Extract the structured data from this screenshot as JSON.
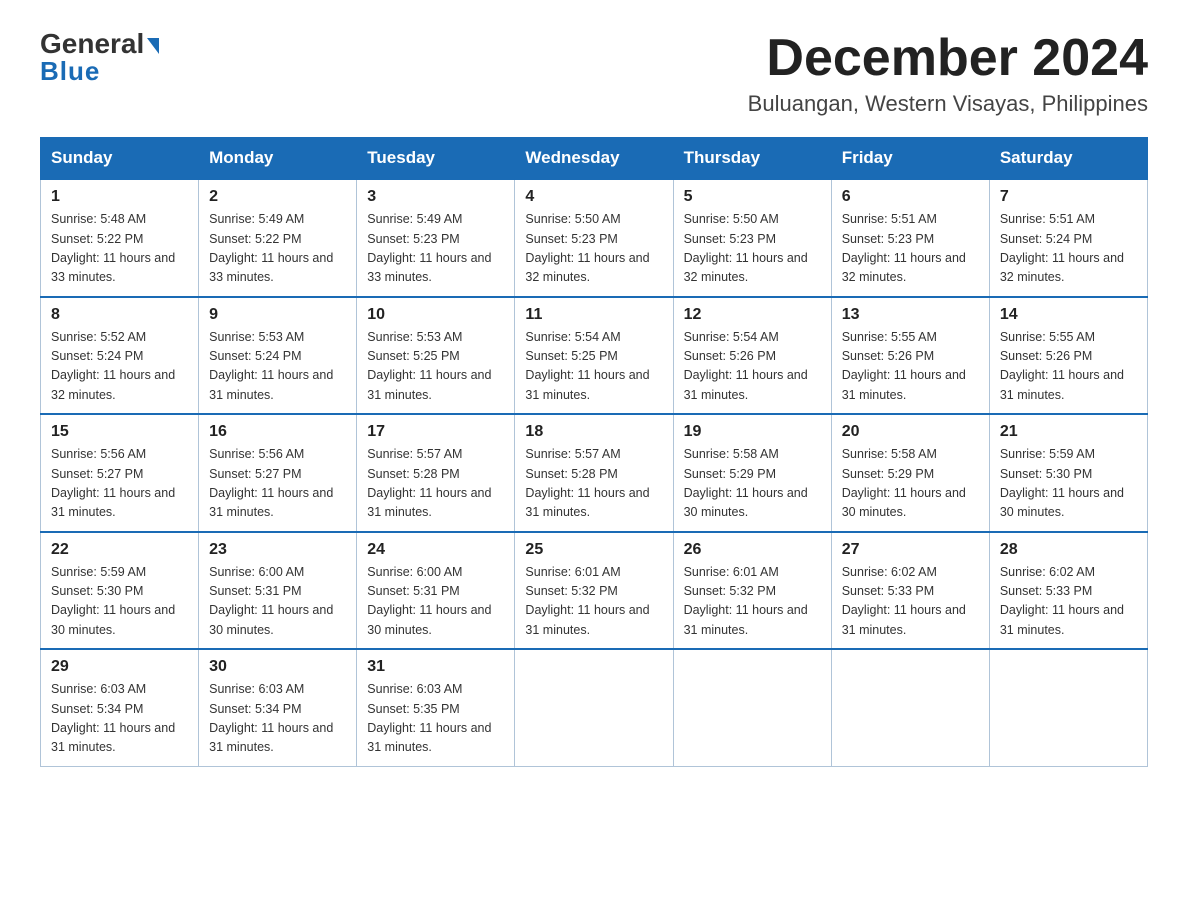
{
  "header": {
    "logo_general": "General",
    "logo_blue": "Blue",
    "month_title": "December 2024",
    "location": "Buluangan, Western Visayas, Philippines"
  },
  "weekdays": [
    "Sunday",
    "Monday",
    "Tuesday",
    "Wednesday",
    "Thursday",
    "Friday",
    "Saturday"
  ],
  "weeks": [
    [
      {
        "day": "1",
        "sunrise": "5:48 AM",
        "sunset": "5:22 PM",
        "daylight": "11 hours and 33 minutes."
      },
      {
        "day": "2",
        "sunrise": "5:49 AM",
        "sunset": "5:22 PM",
        "daylight": "11 hours and 33 minutes."
      },
      {
        "day": "3",
        "sunrise": "5:49 AM",
        "sunset": "5:23 PM",
        "daylight": "11 hours and 33 minutes."
      },
      {
        "day": "4",
        "sunrise": "5:50 AM",
        "sunset": "5:23 PM",
        "daylight": "11 hours and 32 minutes."
      },
      {
        "day": "5",
        "sunrise": "5:50 AM",
        "sunset": "5:23 PM",
        "daylight": "11 hours and 32 minutes."
      },
      {
        "day": "6",
        "sunrise": "5:51 AM",
        "sunset": "5:23 PM",
        "daylight": "11 hours and 32 minutes."
      },
      {
        "day": "7",
        "sunrise": "5:51 AM",
        "sunset": "5:24 PM",
        "daylight": "11 hours and 32 minutes."
      }
    ],
    [
      {
        "day": "8",
        "sunrise": "5:52 AM",
        "sunset": "5:24 PM",
        "daylight": "11 hours and 32 minutes."
      },
      {
        "day": "9",
        "sunrise": "5:53 AM",
        "sunset": "5:24 PM",
        "daylight": "11 hours and 31 minutes."
      },
      {
        "day": "10",
        "sunrise": "5:53 AM",
        "sunset": "5:25 PM",
        "daylight": "11 hours and 31 minutes."
      },
      {
        "day": "11",
        "sunrise": "5:54 AM",
        "sunset": "5:25 PM",
        "daylight": "11 hours and 31 minutes."
      },
      {
        "day": "12",
        "sunrise": "5:54 AM",
        "sunset": "5:26 PM",
        "daylight": "11 hours and 31 minutes."
      },
      {
        "day": "13",
        "sunrise": "5:55 AM",
        "sunset": "5:26 PM",
        "daylight": "11 hours and 31 minutes."
      },
      {
        "day": "14",
        "sunrise": "5:55 AM",
        "sunset": "5:26 PM",
        "daylight": "11 hours and 31 minutes."
      }
    ],
    [
      {
        "day": "15",
        "sunrise": "5:56 AM",
        "sunset": "5:27 PM",
        "daylight": "11 hours and 31 minutes."
      },
      {
        "day": "16",
        "sunrise": "5:56 AM",
        "sunset": "5:27 PM",
        "daylight": "11 hours and 31 minutes."
      },
      {
        "day": "17",
        "sunrise": "5:57 AM",
        "sunset": "5:28 PM",
        "daylight": "11 hours and 31 minutes."
      },
      {
        "day": "18",
        "sunrise": "5:57 AM",
        "sunset": "5:28 PM",
        "daylight": "11 hours and 31 minutes."
      },
      {
        "day": "19",
        "sunrise": "5:58 AM",
        "sunset": "5:29 PM",
        "daylight": "11 hours and 30 minutes."
      },
      {
        "day": "20",
        "sunrise": "5:58 AM",
        "sunset": "5:29 PM",
        "daylight": "11 hours and 30 minutes."
      },
      {
        "day": "21",
        "sunrise": "5:59 AM",
        "sunset": "5:30 PM",
        "daylight": "11 hours and 30 minutes."
      }
    ],
    [
      {
        "day": "22",
        "sunrise": "5:59 AM",
        "sunset": "5:30 PM",
        "daylight": "11 hours and 30 minutes."
      },
      {
        "day": "23",
        "sunrise": "6:00 AM",
        "sunset": "5:31 PM",
        "daylight": "11 hours and 30 minutes."
      },
      {
        "day": "24",
        "sunrise": "6:00 AM",
        "sunset": "5:31 PM",
        "daylight": "11 hours and 30 minutes."
      },
      {
        "day": "25",
        "sunrise": "6:01 AM",
        "sunset": "5:32 PM",
        "daylight": "11 hours and 31 minutes."
      },
      {
        "day": "26",
        "sunrise": "6:01 AM",
        "sunset": "5:32 PM",
        "daylight": "11 hours and 31 minutes."
      },
      {
        "day": "27",
        "sunrise": "6:02 AM",
        "sunset": "5:33 PM",
        "daylight": "11 hours and 31 minutes."
      },
      {
        "day": "28",
        "sunrise": "6:02 AM",
        "sunset": "5:33 PM",
        "daylight": "11 hours and 31 minutes."
      }
    ],
    [
      {
        "day": "29",
        "sunrise": "6:03 AM",
        "sunset": "5:34 PM",
        "daylight": "11 hours and 31 minutes."
      },
      {
        "day": "30",
        "sunrise": "6:03 AM",
        "sunset": "5:34 PM",
        "daylight": "11 hours and 31 minutes."
      },
      {
        "day": "31",
        "sunrise": "6:03 AM",
        "sunset": "5:35 PM",
        "daylight": "11 hours and 31 minutes."
      },
      null,
      null,
      null,
      null
    ]
  ]
}
